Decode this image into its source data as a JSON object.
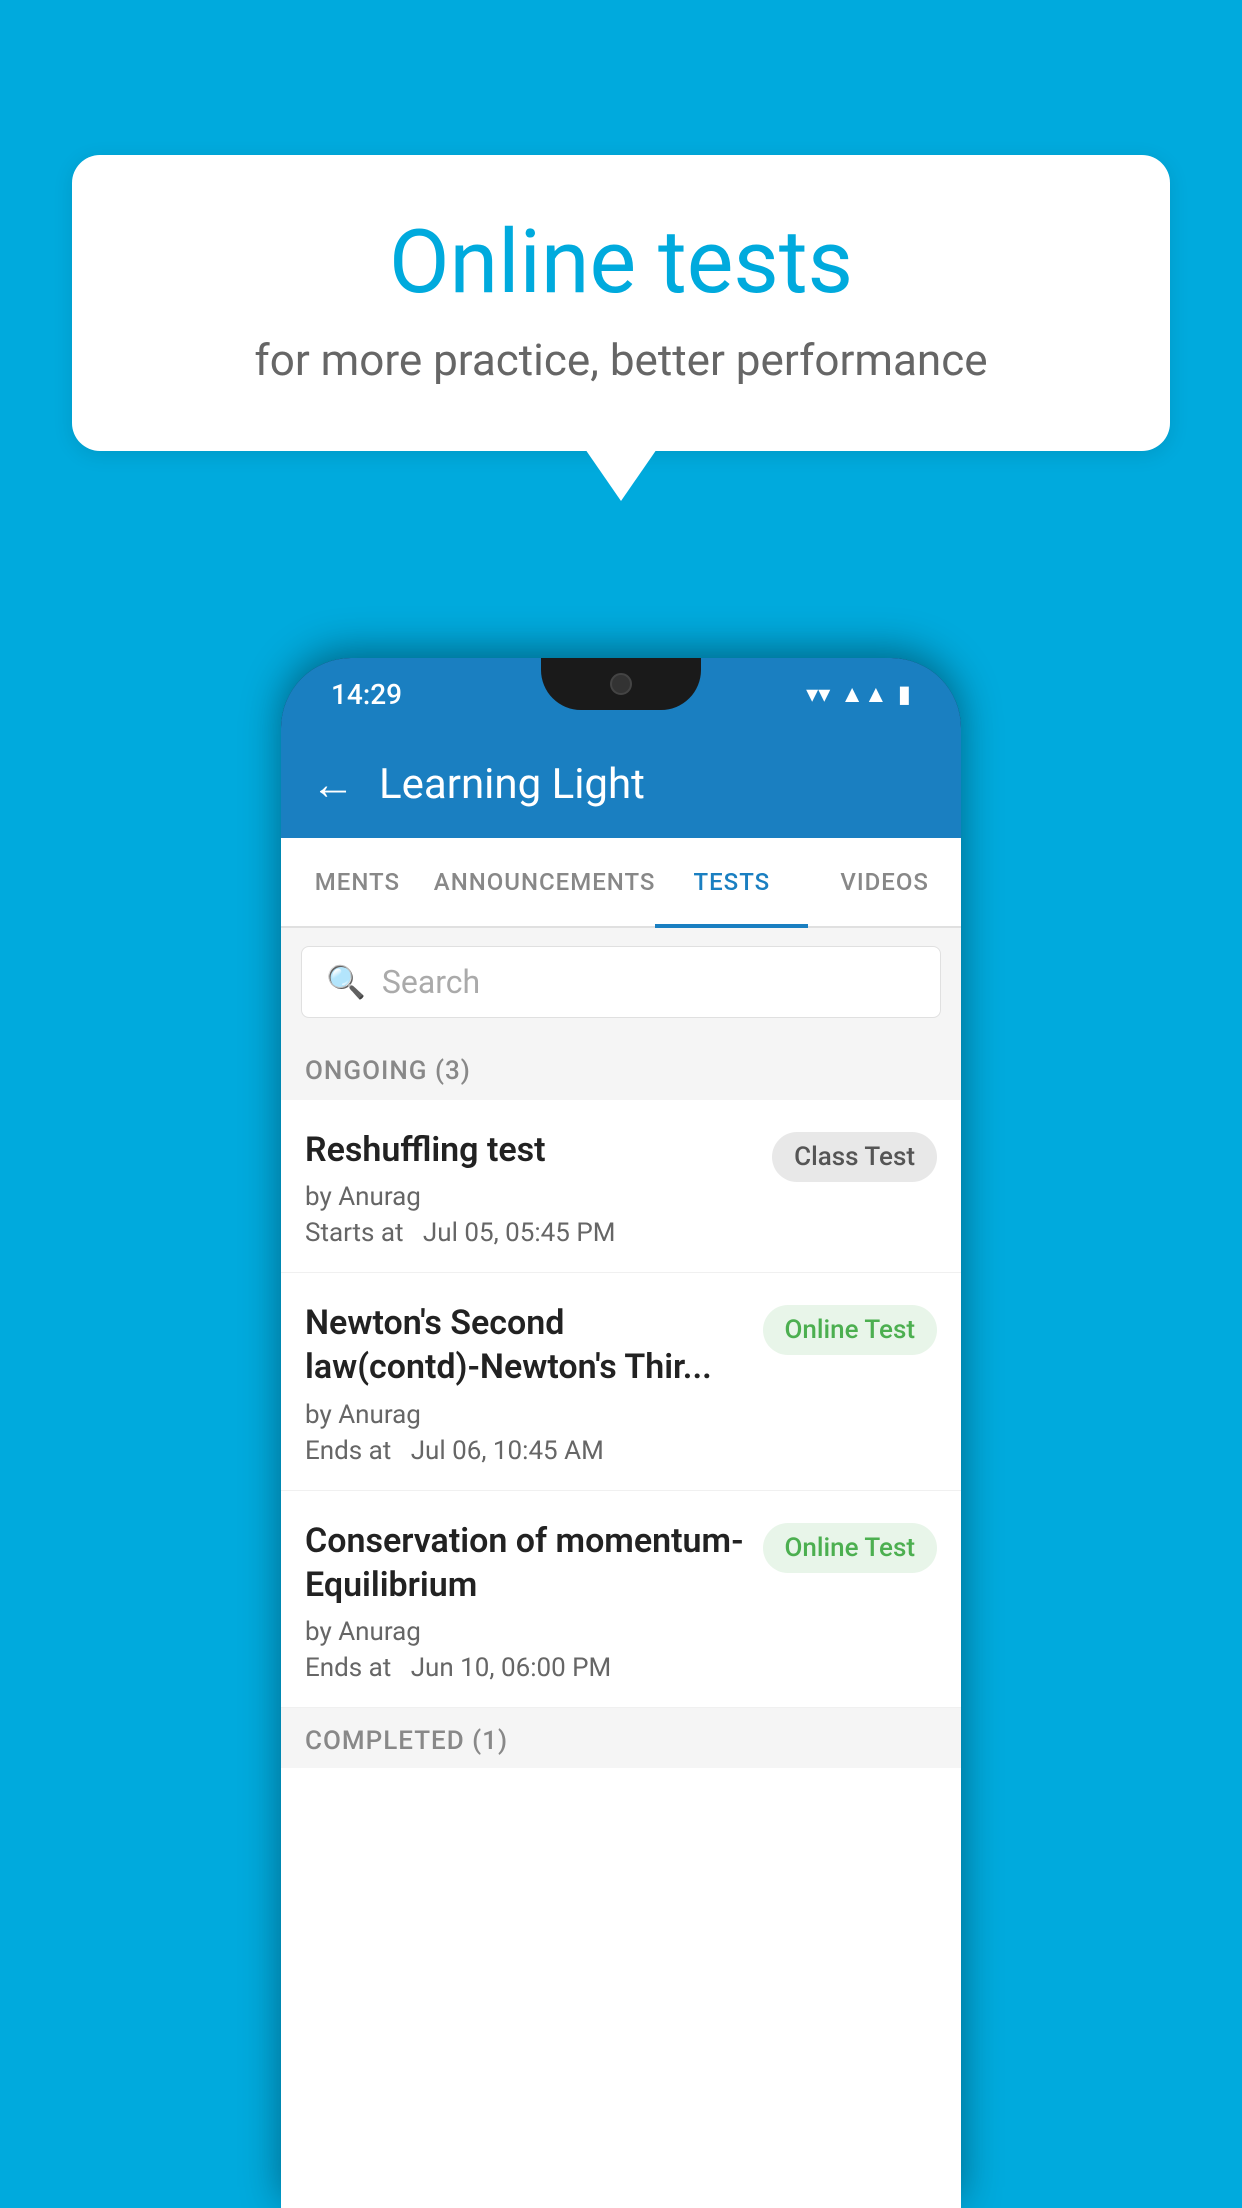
{
  "background": {
    "color": "#00AADD"
  },
  "speech_bubble": {
    "title": "Online tests",
    "subtitle": "for more practice, better performance"
  },
  "phone": {
    "status_bar": {
      "time": "14:29",
      "icons": [
        "wifi",
        "signal",
        "battery"
      ]
    },
    "app_bar": {
      "back_label": "←",
      "title": "Learning Light"
    },
    "tabs": [
      {
        "label": "MENTS",
        "active": false
      },
      {
        "label": "ANNOUNCEMENTS",
        "active": false
      },
      {
        "label": "TESTS",
        "active": true
      },
      {
        "label": "VIDEOS",
        "active": false
      }
    ],
    "search": {
      "placeholder": "Search"
    },
    "ongoing_section": {
      "label": "ONGOING (3)"
    },
    "tests": [
      {
        "name": "Reshuffling test",
        "author": "by Anurag",
        "time_label": "Starts at",
        "time": "Jul 05, 05:45 PM",
        "badge": "Class Test",
        "badge_type": "class"
      },
      {
        "name": "Newton's Second law(contd)-Newton's Thir...",
        "author": "by Anurag",
        "time_label": "Ends at",
        "time": "Jul 06, 10:45 AM",
        "badge": "Online Test",
        "badge_type": "online"
      },
      {
        "name": "Conservation of momentum-Equilibrium",
        "author": "by Anurag",
        "time_label": "Ends at",
        "time": "Jun 10, 06:00 PM",
        "badge": "Online Test",
        "badge_type": "online"
      }
    ],
    "completed_section": {
      "label": "COMPLETED (1)"
    }
  }
}
